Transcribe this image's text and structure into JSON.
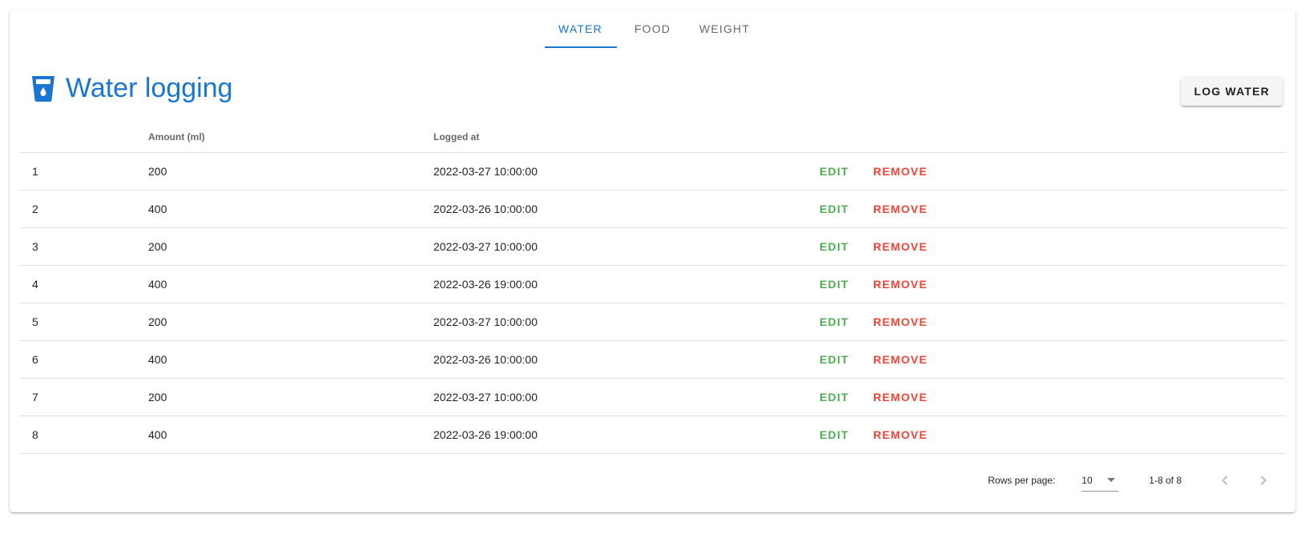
{
  "tabs": [
    {
      "label": "WATER",
      "active": true
    },
    {
      "label": "FOOD",
      "active": false
    },
    {
      "label": "WEIGHT",
      "active": false
    }
  ],
  "header": {
    "icon": "water-cup-icon",
    "title": "Water logging",
    "log_button_label": "LOG WATER"
  },
  "table": {
    "headers": [
      "",
      "Amount (ml)",
      "Logged at"
    ],
    "rows": [
      {
        "index": "1",
        "amount": "200",
        "logged_at": "2022-03-27 10:00:00"
      },
      {
        "index": "2",
        "amount": "400",
        "logged_at": "2022-03-26 10:00:00"
      },
      {
        "index": "3",
        "amount": "200",
        "logged_at": "2022-03-27 10:00:00"
      },
      {
        "index": "4",
        "amount": "400",
        "logged_at": "2022-03-26 19:00:00"
      },
      {
        "index": "5",
        "amount": "200",
        "logged_at": "2022-03-27 10:00:00"
      },
      {
        "index": "6",
        "amount": "400",
        "logged_at": "2022-03-26 10:00:00"
      },
      {
        "index": "7",
        "amount": "200",
        "logged_at": "2022-03-27 10:00:00"
      },
      {
        "index": "8",
        "amount": "400",
        "logged_at": "2022-03-26 19:00:00"
      }
    ],
    "edit_label": "EDIT",
    "remove_label": "REMOVE"
  },
  "pagination": {
    "rows_per_page_label": "Rows per page:",
    "rows_per_page_value": "10",
    "range": "1-8 of 8"
  },
  "colors": {
    "primary": "#1976d2",
    "edit": "#4caf50",
    "remove": "#f44336"
  }
}
